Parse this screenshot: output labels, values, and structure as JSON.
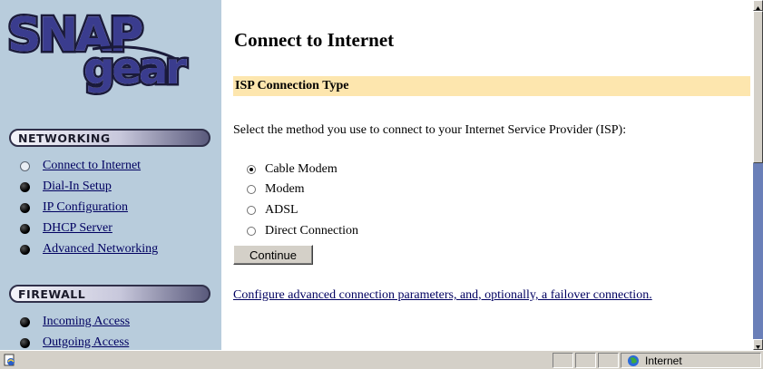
{
  "brand": {
    "logo_text_top": "SNAP",
    "logo_text_bottom": "gear"
  },
  "sidebar": {
    "networking": {
      "title": "NETWORKING",
      "items": [
        {
          "label": "Connect to Internet",
          "active": true
        },
        {
          "label": "Dial-In Setup"
        },
        {
          "label": "IP Configuration"
        },
        {
          "label": "DHCP Server"
        },
        {
          "label": "Advanced Networking"
        }
      ]
    },
    "firewall": {
      "title": "FIREWALL",
      "items": [
        {
          "label": "Incoming Access"
        },
        {
          "label": "Outgoing Access"
        }
      ]
    }
  },
  "main": {
    "title": "Connect to Internet",
    "section": "ISP Connection Type",
    "intro": "Select the method you use to connect to your Internet Service Provider (ISP):",
    "options": [
      {
        "label": "Cable Modem",
        "checked": true
      },
      {
        "label": "Modem"
      },
      {
        "label": "ADSL"
      },
      {
        "label": "Direct Connection"
      }
    ],
    "continue_label": "Continue",
    "advanced_link": "Configure advanced connection parameters, and, optionally, a failover connection."
  },
  "statusbar": {
    "zone": "Internet"
  },
  "colors": {
    "sidebar_bg": "#b8ccdc",
    "section_bar": "#fde6ae",
    "link": "#000060",
    "logo": "#3a3c8e"
  },
  "icons": [
    "page-icon",
    "globe-icon",
    "scroll-up-icon",
    "scroll-down-icon"
  ]
}
